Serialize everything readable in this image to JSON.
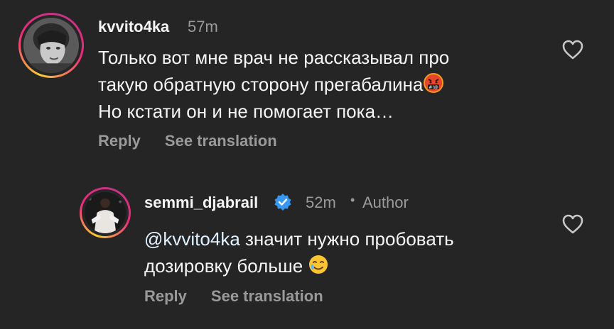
{
  "colors": {
    "background": "#252525",
    "text_primary": "#f5f5f5",
    "text_secondary": "#9a9a9a",
    "verified_blue": "#3897f0"
  },
  "comments": [
    {
      "username": "kvvito4ka",
      "time": "57m",
      "lines": [
        "Только вот мне врач не рассказывал про",
        "такую обратную сторону прегабалина",
        "Но кстати он и не помогает пока…"
      ],
      "emoji": "face-with-symbols-on-mouth",
      "reply_label": "Reply",
      "translation_label": "See translation",
      "like_icon": "heart-outline-icon"
    },
    {
      "username": "semmi_djabrail",
      "time": "52m",
      "separator": "•",
      "author_label": "Author",
      "mention": "@kvvito4ka",
      "line1_rest": " значит нужно пробовать",
      "line2": "дозировку больше ",
      "emoji": "smiling-face-with-tear",
      "reply_label": "Reply",
      "translation_label": "See translation",
      "like_icon": "heart-outline-icon"
    }
  ]
}
